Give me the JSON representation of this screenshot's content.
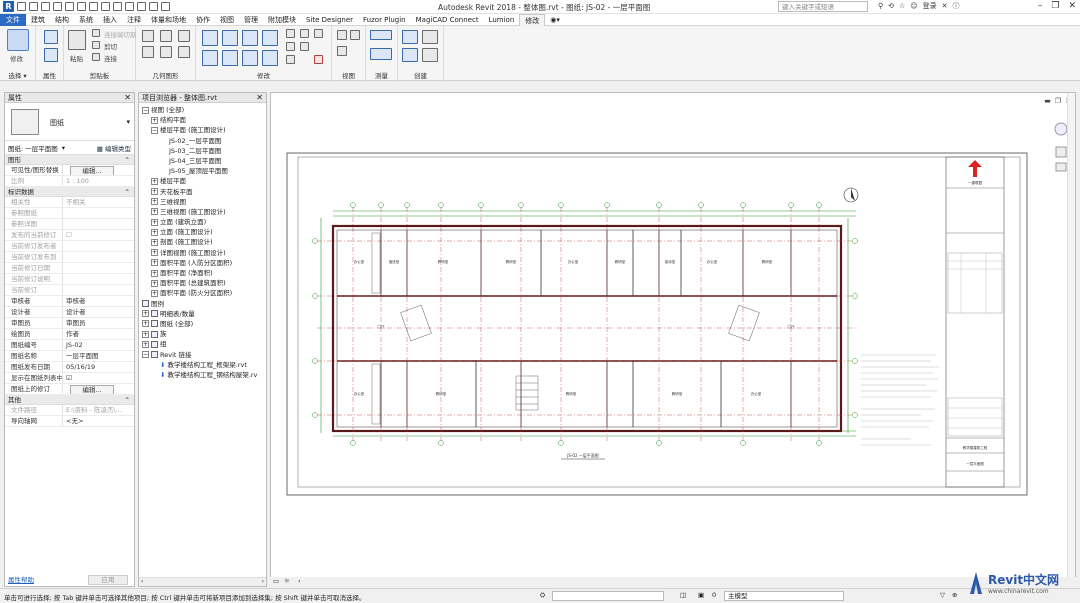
{
  "app": {
    "window_title": "Autodesk Revit 2018 -    整体图.rvt - 图纸: JS-02 - 一层平面图",
    "search_placeholder": "键入关键字或短语",
    "user": "登录",
    "file_tab": "文件",
    "menu_tabs": [
      "建筑",
      "结构",
      "系统",
      "插入",
      "注释",
      "体量和场地",
      "协作",
      "视图",
      "管理",
      "附加模块",
      "Site Designer",
      "Fuzor Plugin",
      "MagiCAD Connect",
      "Lumion",
      "修改"
    ],
    "active_tab": "修改"
  },
  "ribbon": {
    "panels": [
      "选择",
      "属性",
      "剪贴板",
      "几何图形",
      "修改",
      "视图",
      "测量",
      "创建"
    ],
    "modify_label": "修改",
    "paste_label": "粘贴",
    "cut_label": "剪切",
    "join_label": "连接",
    "select_label": "选择 ▾",
    "props_label": "属性",
    "clip_label": "连接端切割"
  },
  "properties": {
    "title": "属性",
    "type_name": "图纸",
    "instance_selector": "图纸: 一层平面图",
    "edit_type": "编辑类型",
    "groups": [
      {
        "name": "图形",
        "rows": [
          {
            "k": "可见性/图形替换",
            "v": "编辑...",
            "btn": true
          },
          {
            "k": "比例",
            "v": "1 : 100",
            "dis": true
          }
        ]
      },
      {
        "name": "标识数据",
        "rows": [
          {
            "k": "相关性",
            "v": "不相关",
            "dis": true
          },
          {
            "k": "参照图纸",
            "v": "",
            "dis": true
          },
          {
            "k": "参照详图",
            "v": "",
            "dis": true
          },
          {
            "k": "发布的当前修订",
            "v": "☐",
            "dis": true
          },
          {
            "k": "当前修订发布者",
            "v": "",
            "dis": true
          },
          {
            "k": "当前修订发布到",
            "v": "",
            "dis": true
          },
          {
            "k": "当前修订日期",
            "v": "",
            "dis": true
          },
          {
            "k": "当前修订说明",
            "v": "",
            "dis": true
          },
          {
            "k": "当前修订",
            "v": "",
            "dis": true
          },
          {
            "k": "审核者",
            "v": "审核者"
          },
          {
            "k": "设计者",
            "v": "设计者"
          },
          {
            "k": "审图员",
            "v": "审图员"
          },
          {
            "k": "绘图员",
            "v": "作者"
          },
          {
            "k": "图纸编号",
            "v": "JS-02"
          },
          {
            "k": "图纸名称",
            "v": "一层平面图"
          },
          {
            "k": "图纸发布日期",
            "v": "05/16/19"
          },
          {
            "k": "显示在图纸列表中",
            "v": "☑"
          },
          {
            "k": "图纸上的修订",
            "v": "编辑...",
            "btn": true
          }
        ]
      },
      {
        "name": "其他",
        "rows": [
          {
            "k": "文件路径",
            "v": "E:\\资料 - 陈凌杰\\...",
            "dis": true
          },
          {
            "k": "导向轴网",
            "v": "<无>"
          }
        ]
      }
    ],
    "help_link": "属性帮助",
    "apply": "应用"
  },
  "browser": {
    "title": "项目浏览器 - 整体图.rvt",
    "nodes": [
      {
        "t": "视图 (全部)",
        "lvl": 0,
        "exp": "−"
      },
      {
        "t": "结构平面",
        "lvl": 1,
        "exp": "+"
      },
      {
        "t": "楼层平面 (施工图设计)",
        "lvl": 1,
        "exp": "−"
      },
      {
        "t": "JS-02_一层平面图",
        "lvl": 3
      },
      {
        "t": "JS-03_二层平面图",
        "lvl": 3
      },
      {
        "t": "JS-04_三层平面图",
        "lvl": 3
      },
      {
        "t": "JS-05_屋顶层平面图",
        "lvl": 3
      },
      {
        "t": "楼层平面",
        "lvl": 1,
        "exp": "+"
      },
      {
        "t": "天花板平面",
        "lvl": 1,
        "exp": "+"
      },
      {
        "t": "三维视图",
        "lvl": 1,
        "exp": "+"
      },
      {
        "t": "三维视图 (施工图设计)",
        "lvl": 1,
        "exp": "+"
      },
      {
        "t": "立面 (建筑立面)",
        "lvl": 1,
        "exp": "+"
      },
      {
        "t": "立面 (施工图设计)",
        "lvl": 1,
        "exp": "+"
      },
      {
        "t": "剖面 (施工图设计)",
        "lvl": 1,
        "exp": "+"
      },
      {
        "t": "详图视图 (施工图设计)",
        "lvl": 1,
        "exp": "+"
      },
      {
        "t": "面积平面 (人防分区面积)",
        "lvl": 1,
        "exp": "+"
      },
      {
        "t": "面积平面 (净面积)",
        "lvl": 1,
        "exp": "+"
      },
      {
        "t": "面积平面 (总建筑面积)",
        "lvl": 1,
        "exp": "+"
      },
      {
        "t": "面积平面 (防火分区面积)",
        "lvl": 1,
        "exp": "+"
      },
      {
        "t": "图例",
        "lvl": 0,
        "icon": true
      },
      {
        "t": "明细表/数量",
        "lvl": 0,
        "exp": "+",
        "icon": true
      },
      {
        "t": "图纸 (全部)",
        "lvl": 0,
        "exp": "+",
        "icon": true
      },
      {
        "t": "族",
        "lvl": 0,
        "exp": "+",
        "icon": true
      },
      {
        "t": "组",
        "lvl": 0,
        "exp": "+",
        "icon": true
      },
      {
        "t": "Revit 链接",
        "lvl": 0,
        "exp": "−",
        "icon": true
      },
      {
        "t": "教学楼结构工程_框架梁.rvt",
        "lvl": 2,
        "link": true
      },
      {
        "t": "教学楼结构工程_钢结构屋架.rv",
        "lvl": 2,
        "link": true
      }
    ]
  },
  "drawing": {
    "view_caption": "JS-02 一层平面图",
    "title_block_logo": "一建联盟",
    "title_block_name": "教学楼建筑工程",
    "title_block_sheet": "一层平面图",
    "rooms": [
      "办公室",
      "值班室",
      "教研室",
      "教研室",
      "办公室",
      "教研室",
      "接待室",
      "办公室",
      "教研室",
      "门厅",
      "门厅",
      "办公室",
      "教研室",
      "教研室",
      "教研室",
      "办公室"
    ]
  },
  "statusbar": {
    "message": "单击可进行选择; 按 Tab 键并单击可选择其他项目; 按 Ctrl 键并单击可将新项目添加到选择集; 按 Shift 键并单击可取消选择。",
    "model": "主模型",
    "coord": "0"
  },
  "watermark": {
    "text": "Revit中文网",
    "url": "www.chinarevit.com"
  }
}
